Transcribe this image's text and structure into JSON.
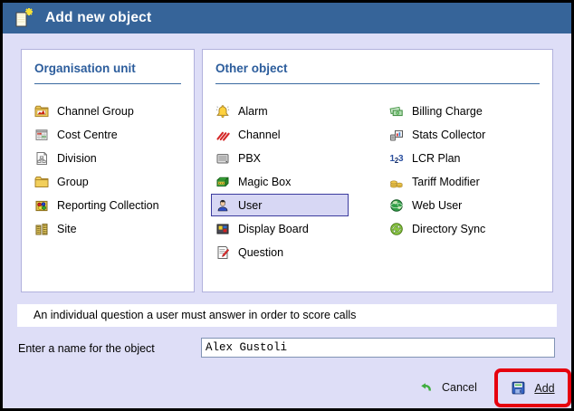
{
  "title_bar": {
    "title": "Add new object"
  },
  "icons": {
    "title": "new-document",
    "cancel": "undo-arrow",
    "add": "save-floppy"
  },
  "panels": {
    "left": {
      "heading": "Organisation unit",
      "items": [
        {
          "label": "Channel Group",
          "icon": "folder-chart"
        },
        {
          "label": "Cost Centre",
          "icon": "cost-grid"
        },
        {
          "label": "Division",
          "icon": "org-chart"
        },
        {
          "label": "Group",
          "icon": "folder"
        },
        {
          "label": "Reporting Collection",
          "icon": "report-collection"
        },
        {
          "label": "Site",
          "icon": "buildings"
        }
      ]
    },
    "right": {
      "heading": "Other object",
      "col1": [
        {
          "label": "Alarm",
          "icon": "alarm-bell"
        },
        {
          "label": "Channel",
          "icon": "channel-lines"
        },
        {
          "label": "PBX",
          "icon": "pbx-box"
        },
        {
          "label": "Magic Box",
          "icon": "magic-box"
        },
        {
          "label": "User",
          "icon": "user-person",
          "selected": true
        },
        {
          "label": "Display Board",
          "icon": "display-board"
        },
        {
          "label": "Question",
          "icon": "question-pencil"
        }
      ],
      "col2": [
        {
          "label": "Billing Charge",
          "icon": "billing-money"
        },
        {
          "label": "Stats Collector",
          "icon": "stats-device"
        },
        {
          "label": "LCR Plan",
          "icon": "lcr-123"
        },
        {
          "label": "Tariff Modifier",
          "icon": "tariff-coins"
        },
        {
          "label": "Web User",
          "icon": "web-globe"
        },
        {
          "label": "Directory Sync",
          "icon": "sync-arrows"
        }
      ]
    }
  },
  "description": "An individual question a user must answer in order to score calls",
  "name_field": {
    "label": "Enter a name for the object",
    "value": "Alex Gustoli"
  },
  "footer": {
    "cancel_label": "Cancel",
    "add_label": "Add"
  },
  "colors": {
    "titlebar": "#366499",
    "dialog_background": "#dedef7",
    "heading": "#2c5d9c",
    "selected_item_bg": "#d7d7f4",
    "selected_item_border": "#3b3b9e",
    "highlight_annotation": "#e6000e"
  }
}
